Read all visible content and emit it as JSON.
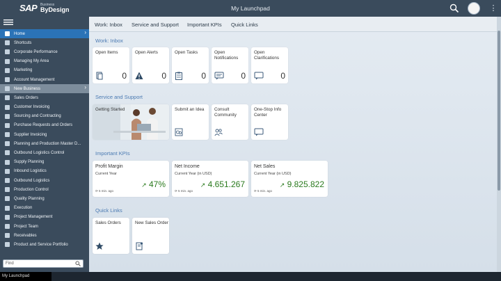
{
  "shell": {
    "logo_sap": "SAP",
    "logo_business": "Business",
    "logo_bydesign": "ByDesign",
    "title": "My Launchpad"
  },
  "nav": {
    "items": [
      {
        "label": "Home"
      },
      {
        "label": "Shortcuts"
      },
      {
        "label": "Corporate Performance"
      },
      {
        "label": "Managing My Area"
      },
      {
        "label": "Marketing"
      },
      {
        "label": "Account Management"
      },
      {
        "label": "New Business"
      },
      {
        "label": "Sales Orders"
      },
      {
        "label": "Customer Invoicing"
      },
      {
        "label": "Sourcing and Contracting"
      },
      {
        "label": "Purchase Requests and Orders"
      },
      {
        "label": "Supplier Invoicing"
      },
      {
        "label": "Planning and Production Master D..."
      },
      {
        "label": "Outbound Logistics Control"
      },
      {
        "label": "Supply Planning"
      },
      {
        "label": "Inbound Logistics"
      },
      {
        "label": "Outbound Logistics"
      },
      {
        "label": "Production Control"
      },
      {
        "label": "Quality Planning"
      },
      {
        "label": "Execution"
      },
      {
        "label": "Project Management"
      },
      {
        "label": "Project Team"
      },
      {
        "label": "Receivables"
      },
      {
        "label": "Product and Service Portfolio"
      }
    ],
    "find_placeholder": "Find",
    "arrow": "›"
  },
  "anchor": {
    "tabs": [
      "Work: Inbox",
      "Service and Support",
      "Important KPIs",
      "Quick Links"
    ]
  },
  "sections": {
    "inbox": "Work: Inbox",
    "service": "Service and Support",
    "kpis": "Important KPIs",
    "links": "Quick Links"
  },
  "inbox_tiles": [
    {
      "title": "Open Items",
      "count": "0",
      "icon": "document-icon"
    },
    {
      "title": "Open Alerts",
      "count": "0",
      "icon": "warning-icon"
    },
    {
      "title": "Open Tasks",
      "count": "0",
      "icon": "tasks-icon"
    },
    {
      "title": "Open Notifications",
      "count": "0",
      "icon": "message-icon"
    },
    {
      "title": "Open Clarifications",
      "count": "0",
      "icon": "chat-icon"
    }
  ],
  "service_tiles": [
    {
      "title": "Getting Started"
    },
    {
      "title": "Submit an Idea"
    },
    {
      "title": "Consult Community"
    },
    {
      "title": "One-Stop Info Center"
    }
  ],
  "kpi_tiles": [
    {
      "title": "Profit Margin",
      "sub": "Current Year",
      "value": "47%",
      "ago": "5 min. ago"
    },
    {
      "title": "Net Income",
      "sub": "Current Year (in USD)",
      "value": "4.651.267",
      "ago": "5 min. ago"
    },
    {
      "title": "Net Sales",
      "sub": "Current Year (in USD)",
      "value": "9.825.822",
      "ago": "5 min. ago"
    }
  ],
  "link_tiles": [
    {
      "title": "Sales Orders"
    },
    {
      "title": "New Sales Order"
    }
  ],
  "statusbar": {
    "tab": "My Launchpad"
  },
  "colors": {
    "shell": "#3a4b5c",
    "home": "#2b73b7",
    "kpi_green": "#2a7a1d",
    "section": "#4b7ab2"
  }
}
